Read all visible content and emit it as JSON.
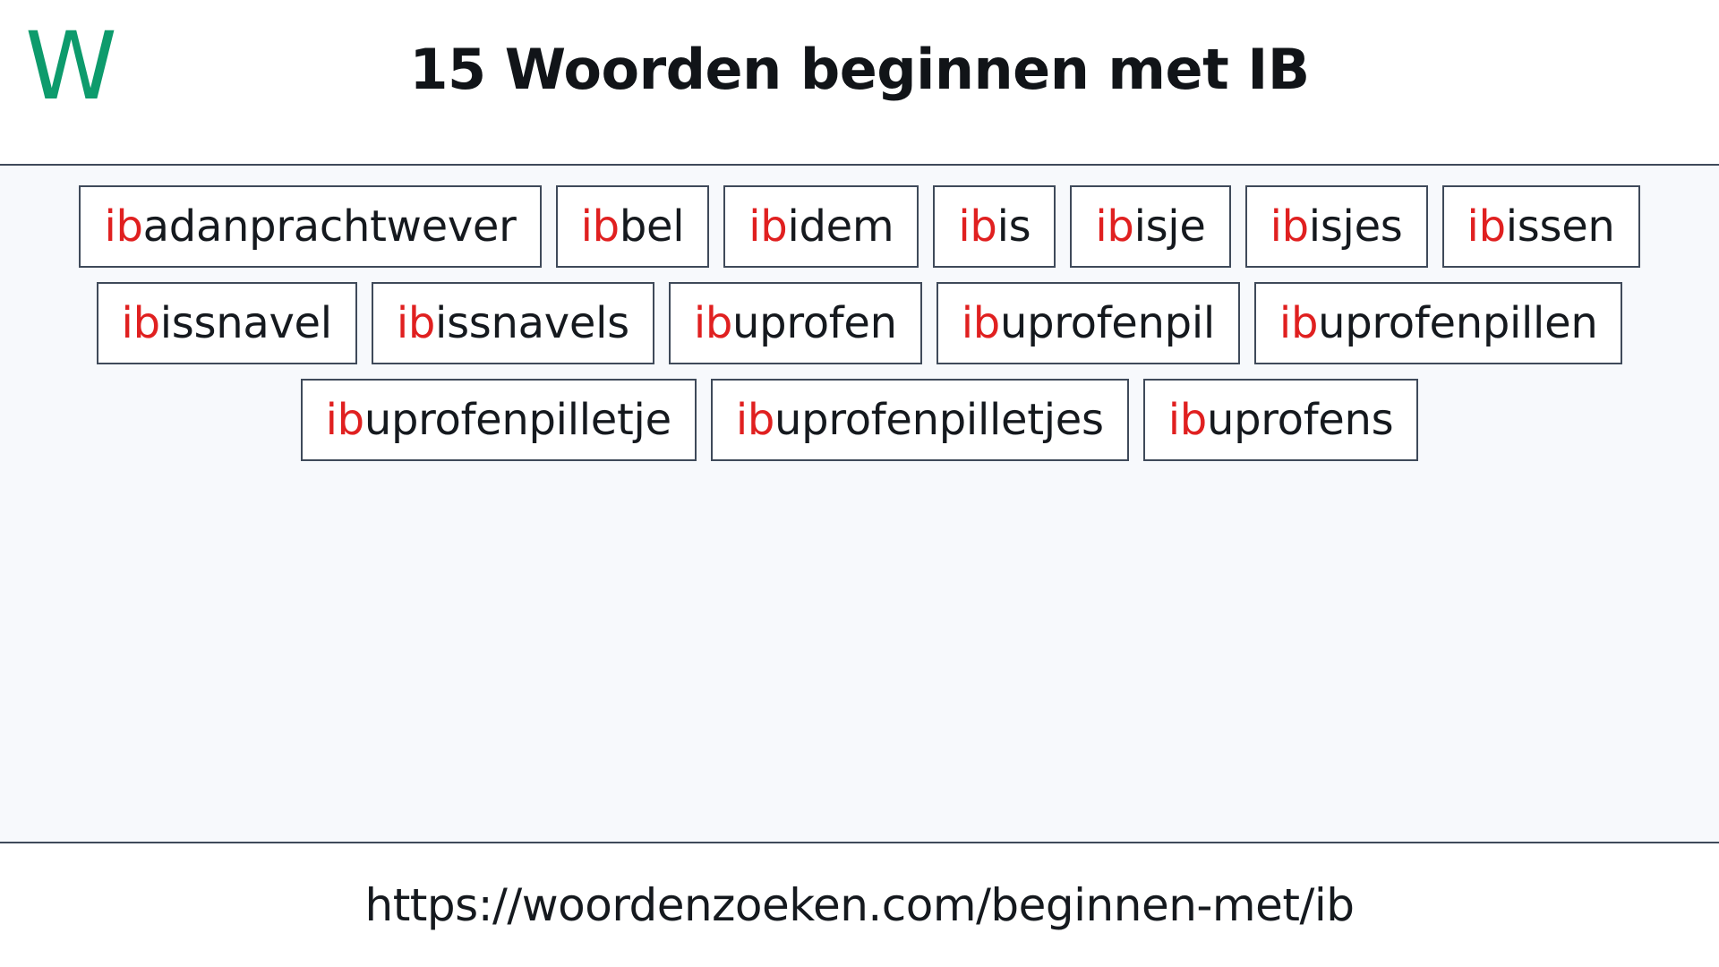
{
  "header": {
    "logo_text": "W",
    "logo_color": "#0d9b6c",
    "title": "15 Woorden beginnen met IB"
  },
  "theme": {
    "highlight_color": "#e02020",
    "border_color": "#3f4a5a",
    "panel_background": "#f7f9fc",
    "text_color": "#15191e"
  },
  "main": {
    "prefix": "ib",
    "word_count": 15,
    "rows": [
      [
        {
          "prefix": "ib",
          "rest": "adanprachtwever"
        },
        {
          "prefix": "ib",
          "rest": "bel"
        },
        {
          "prefix": "ib",
          "rest": "idem"
        },
        {
          "prefix": "ib",
          "rest": "is"
        },
        {
          "prefix": "ib",
          "rest": "isje"
        },
        {
          "prefix": "ib",
          "rest": "isjes"
        },
        {
          "prefix": "ib",
          "rest": "issen"
        }
      ],
      [
        {
          "prefix": "ib",
          "rest": "issnavel"
        },
        {
          "prefix": "ib",
          "rest": "issnavels"
        },
        {
          "prefix": "ib",
          "rest": "uprofen"
        },
        {
          "prefix": "ib",
          "rest": "uprofenpil"
        },
        {
          "prefix": "ib",
          "rest": "uprofenpillen"
        }
      ],
      [
        {
          "prefix": "ib",
          "rest": "uprofenpilletje"
        },
        {
          "prefix": "ib",
          "rest": "uprofenpilletjes"
        },
        {
          "prefix": "ib",
          "rest": "uprofens"
        }
      ]
    ]
  },
  "footer": {
    "url": "https://woordenzoeken.com/beginnen-met/ib"
  }
}
